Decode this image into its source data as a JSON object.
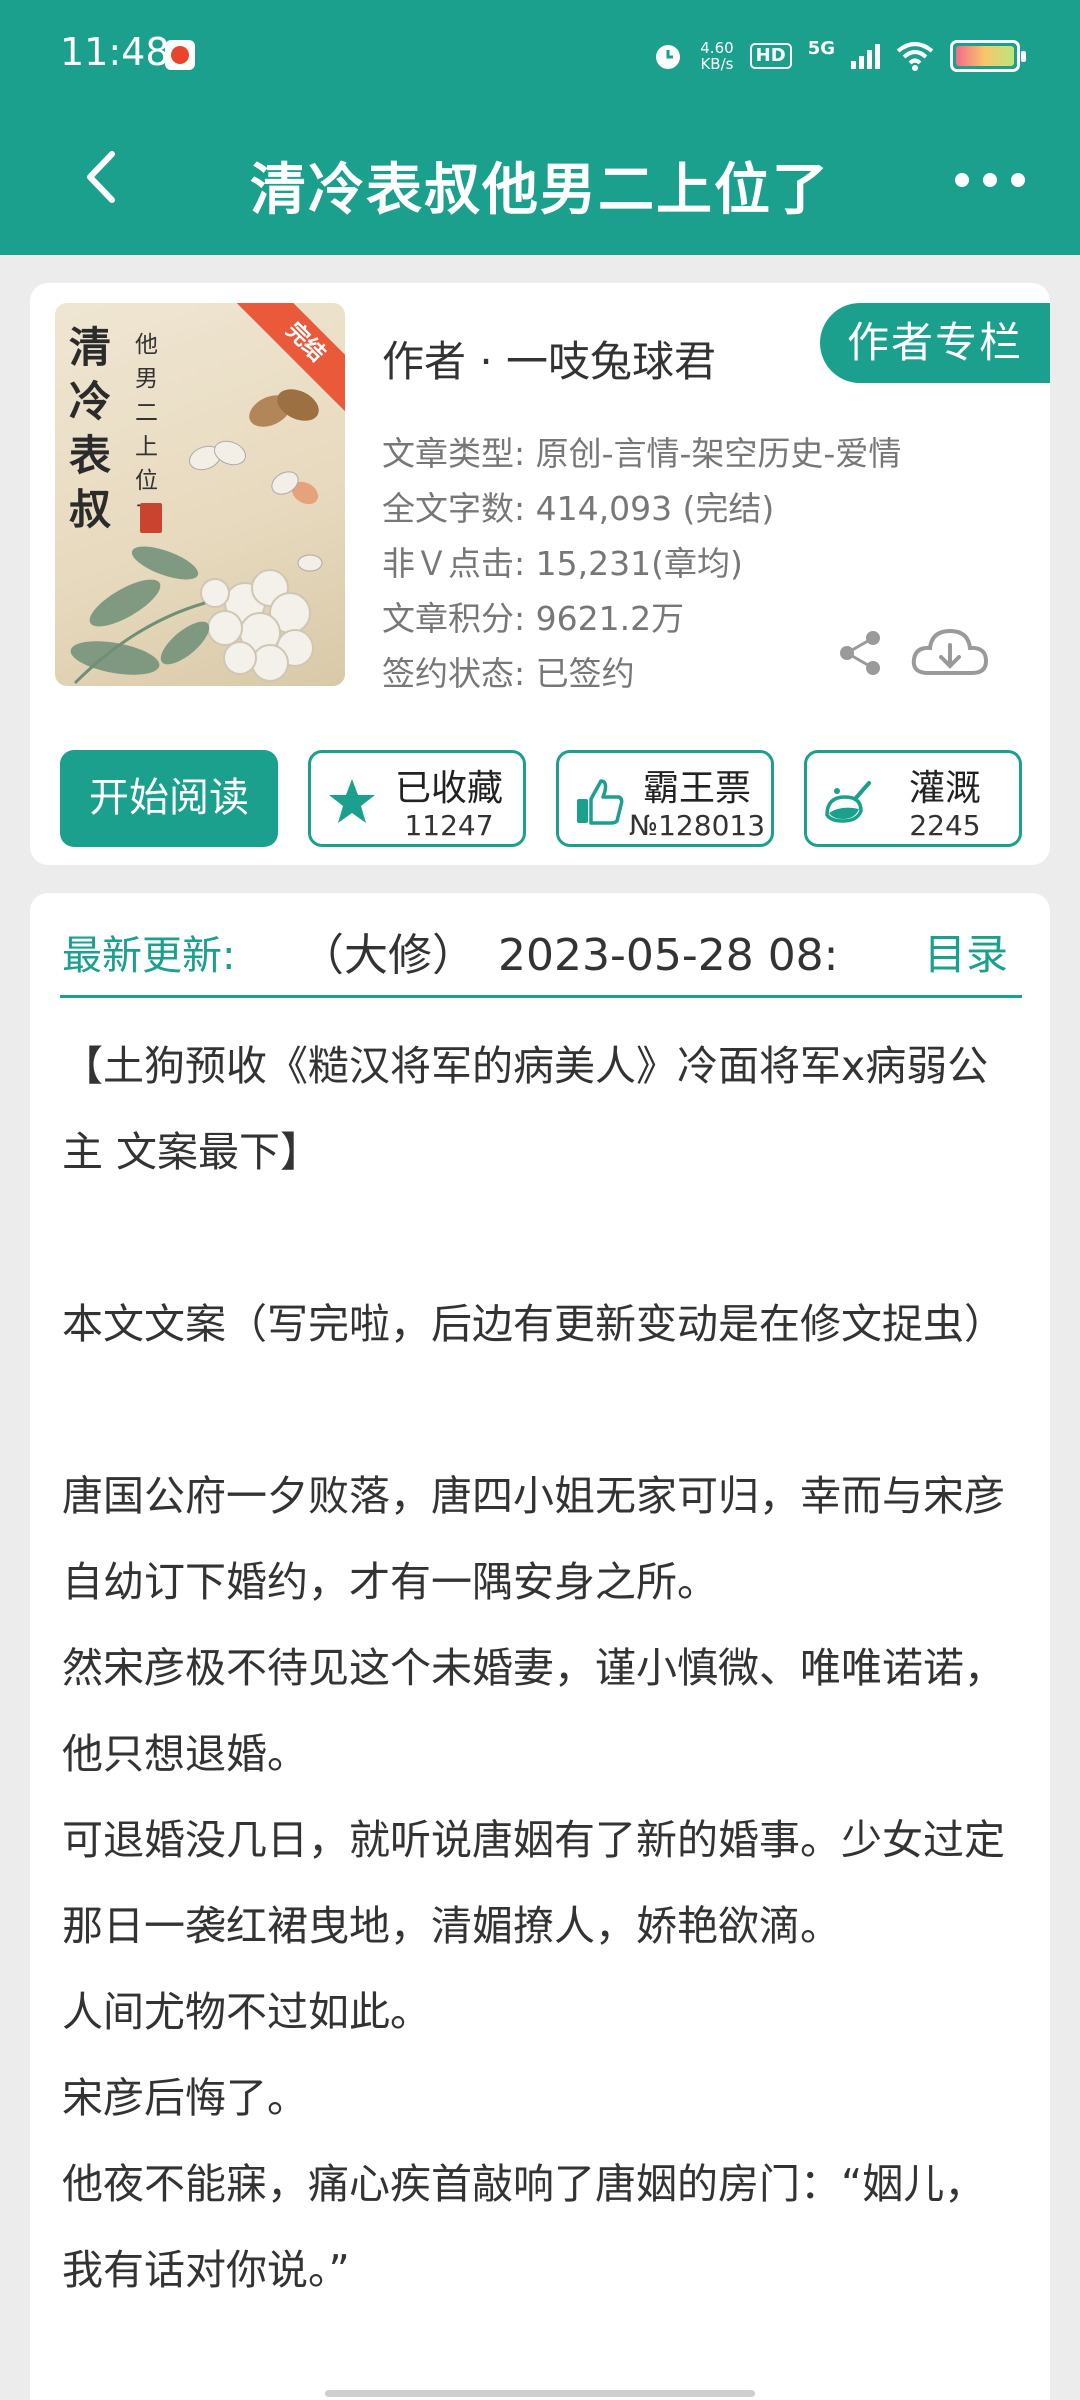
{
  "status_bar": {
    "time": "11:48",
    "net_speed_value": "4.60",
    "net_speed_unit": "KB/s",
    "hd": "HD",
    "network": "5G"
  },
  "nav": {
    "title": "清冷表叔他男二上位了"
  },
  "book": {
    "cover_title": "清冷表叔",
    "cover_subtitle": "他男二上位了",
    "cover_ribbon": "完结",
    "author_line": "作者 · 一吱兔球君",
    "author_column_button": "作者专栏",
    "meta": {
      "type": "文章类型: 原创-言情-架空历史-爱情",
      "words": "全文字数: 414,093 (完结)",
      "clicks": "非Ｖ点击: 15,231(章均)",
      "score": "文章积分: 9621.2万",
      "sign": "签约状态: 已签约"
    },
    "start_reading": "开始阅读",
    "stats": [
      {
        "label": "已收藏",
        "value": "11247",
        "icon": "star-icon"
      },
      {
        "label": "霸王票",
        "value": "№128013",
        "icon": "thumbs-up-icon"
      },
      {
        "label": "灌溉",
        "value": "2245",
        "icon": "watering-icon"
      }
    ]
  },
  "update": {
    "label": "最新更新:",
    "text": "（大修）　2023-05-28 08:",
    "catalog": "目录"
  },
  "synopsis": [
    "【土狗预收《糙汉将军的病美人》冷面将军x病弱公主 文案最下】",
    "",
    "本文文案（写完啦，后边有更新变动是在修文捉虫）",
    "",
    "唐国公府一夕败落，唐四小姐无家可归，幸而与宋彦自幼订下婚约，才有一隅安身之所。",
    "然宋彦极不待见这个未婚妻，谨小慎微、唯唯诺诺，他只想退婚。",
    "可退婚没几日，就听说唐姻有了新的婚事。少女过定那日一袭红裙曳地，清媚撩人，娇艳欲滴。",
    "人间尤物不过如此。",
    "宋彦后悔了。",
    "他夜不能寐，痛心疾首敲响了唐姻的房门：“姻儿，我有话对你说。”"
  ],
  "colors": {
    "accent": "#1aa08c",
    "ribbon": "#e9593a"
  }
}
